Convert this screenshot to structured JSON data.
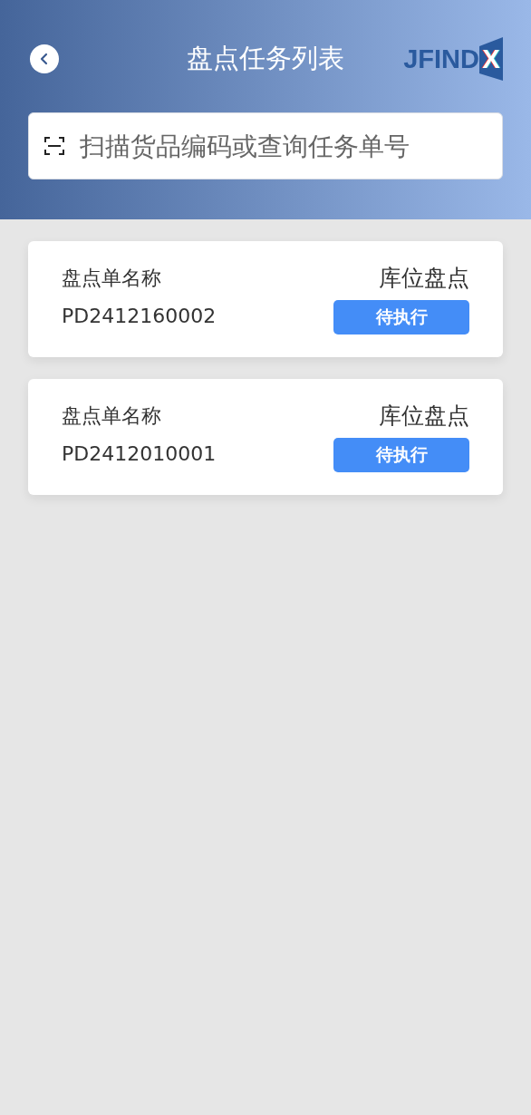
{
  "header": {
    "title": "盘点任务列表",
    "logo": {
      "text": "JFIND",
      "mark": "X"
    }
  },
  "search": {
    "placeholder": "扫描货品编码或查询任务单号"
  },
  "tasks": [
    {
      "label": "盘点单名称",
      "number": "PD2412160002",
      "type": "库位盘点",
      "status": "待执行"
    },
    {
      "label": "盘点单名称",
      "number": "PD2412010001",
      "type": "库位盘点",
      "status": "待执行"
    }
  ]
}
